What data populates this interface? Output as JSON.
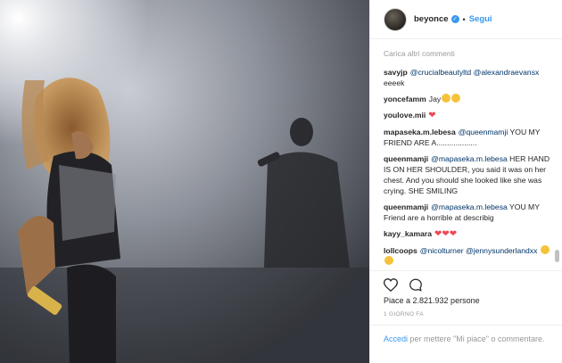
{
  "post": {
    "username": "beyonce",
    "verified_glyph": "✓",
    "separator": "•",
    "follow_label": "Segui",
    "load_more": "Carica altri commenti",
    "likes_text": "Piace a 2.821.932 persone",
    "date_text": "1 GIORNO FA"
  },
  "comments": [
    {
      "author": "savyjp",
      "parts": [
        [
          "mention",
          "@crucialbeautyltd"
        ],
        [
          "text",
          " "
        ],
        [
          "mention",
          "@alexandraevansx"
        ],
        [
          "text",
          " eeeek"
        ]
      ]
    },
    {
      "author": "yoncefamm",
      "parts": [
        [
          "text",
          "Jay"
        ],
        [
          "emoji",
          "😉"
        ],
        [
          "emoji",
          "😉"
        ]
      ]
    },
    {
      "author": "youlove.mii",
      "parts": [
        [
          "heart",
          "❤"
        ]
      ]
    },
    {
      "author": "mapaseka.m.lebesa",
      "parts": [
        [
          "mention",
          "@queenmamji"
        ],
        [
          "text",
          " YOU MY FRIEND ARE A..................."
        ]
      ]
    },
    {
      "author": "queenmamji",
      "parts": [
        [
          "mention",
          "@mapaseka.m.lebesa"
        ],
        [
          "text",
          " HER HAND IS ON HER SHOULDER, you said it was on her chest. And you should she looked like she was crying. SHE SMILING"
        ]
      ]
    },
    {
      "author": "queenmamji",
      "parts": [
        [
          "mention",
          "@mapaseka.m.lebesa"
        ],
        [
          "text",
          " YOU MY Friend are a horrible at describig"
        ]
      ]
    },
    {
      "author": "kayy_kamara",
      "parts": [
        [
          "heart",
          "❤"
        ],
        [
          "heart",
          "❤"
        ],
        [
          "heart",
          "❤"
        ]
      ]
    },
    {
      "author": "lollcoops",
      "parts": [
        [
          "mention",
          "@nicolturner"
        ],
        [
          "text",
          " "
        ],
        [
          "mention",
          "@jennysunderlandxx"
        ],
        [
          "text",
          " "
        ],
        [
          "emoji",
          "😁"
        ],
        [
          "emoji",
          "😁"
        ]
      ]
    },
    {
      "author": "",
      "parts": [
        [
          "text",
          "          "
        ]
      ]
    }
  ],
  "login": {
    "link": "Accedi",
    "rest": " per mettere \"Mi piace\" o commentare."
  },
  "icons": {
    "like": "heart-outline-icon",
    "comment": "comment-bubble-icon"
  }
}
